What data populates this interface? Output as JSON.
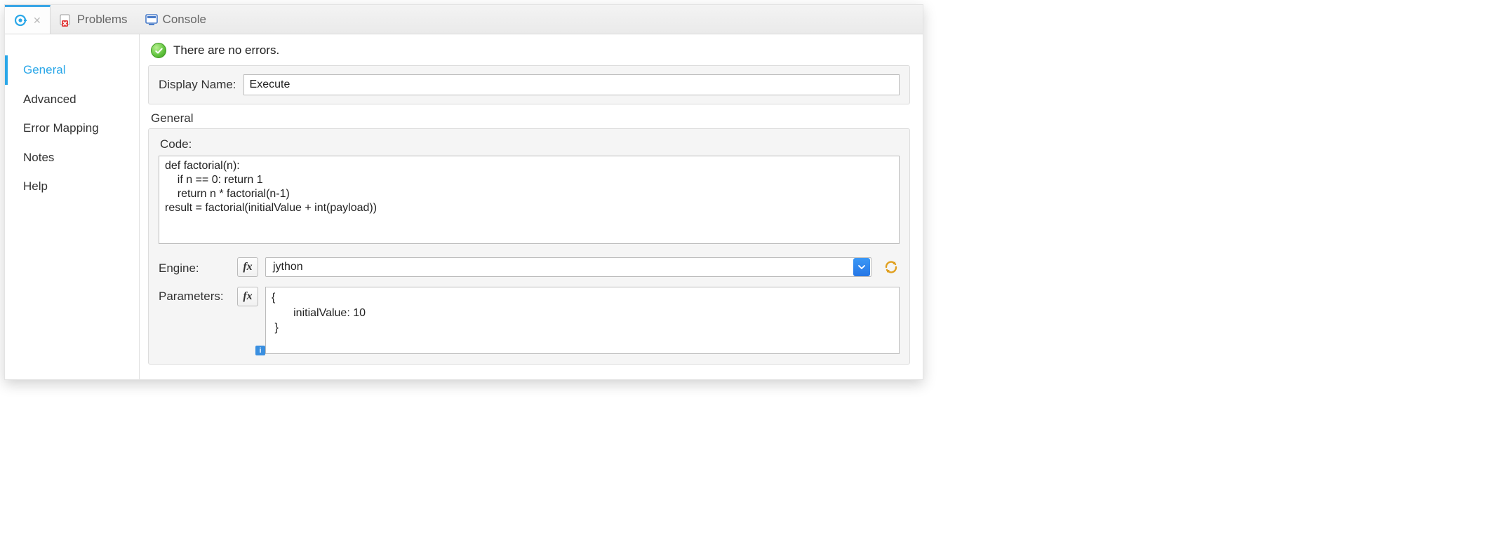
{
  "tabs": {
    "problems": "Problems",
    "console": "Console"
  },
  "sidebar": {
    "items": [
      {
        "label": "General",
        "selected": true
      },
      {
        "label": "Advanced",
        "selected": false
      },
      {
        "label": "Error Mapping",
        "selected": false
      },
      {
        "label": "Notes",
        "selected": false
      },
      {
        "label": "Help",
        "selected": false
      }
    ]
  },
  "status": {
    "message": "There are no errors."
  },
  "form": {
    "display_name_label": "Display Name:",
    "display_name_value": "Execute",
    "section_heading": "General",
    "code_label": "Code:",
    "code_value": "def factorial(n):\n    if n == 0: return 1\n    return n * factorial(n-1)\nresult = factorial(initialValue + int(payload))",
    "engine_label": "Engine:",
    "engine_value": "jython",
    "parameters_label": "Parameters:",
    "parameters_value": "{\n       initialValue: 10\n }",
    "fx_label": "fx",
    "info_badge": "i"
  }
}
